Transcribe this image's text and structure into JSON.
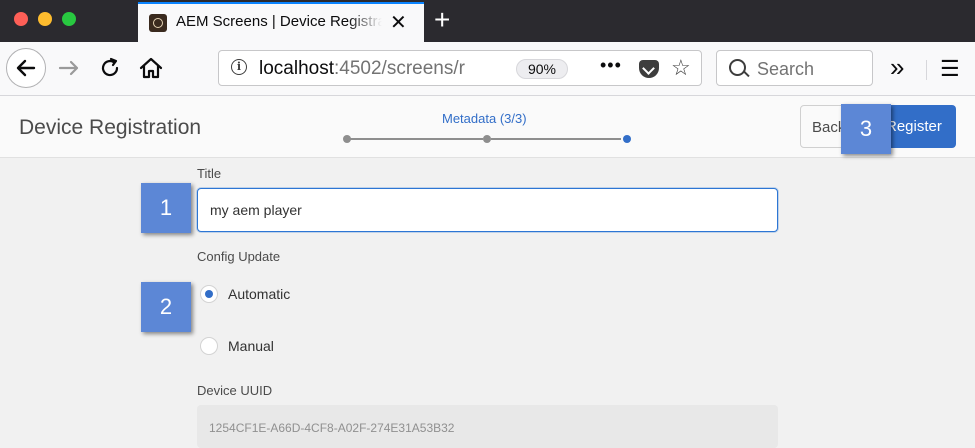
{
  "browser": {
    "tab_title": "AEM Screens | Device Registration",
    "tab_close": "✕",
    "new_tab": "+",
    "url_host": "localhost",
    "url_rest": ":4502/screens/r",
    "zoom": "90%",
    "page_actions": "•••",
    "search_placeholder": "Search",
    "overflow": "»",
    "menu": "☰"
  },
  "page": {
    "title": "Device Registration",
    "step_label": "Metadata (3/3)",
    "step_current": 3,
    "step_total": 3,
    "back_label": "Back",
    "register_label": "Register"
  },
  "form": {
    "title_label": "Title",
    "title_value": "my aem player",
    "config_label": "Config Update",
    "options": [
      "Automatic",
      "Manual"
    ],
    "selected": "Automatic",
    "uuid_label": "Device UUID",
    "uuid_value": "1254CF1E-A66D-4CF8-A02F-274E31A53B32"
  },
  "callouts": [
    "1",
    "2",
    "3"
  ],
  "colors": {
    "accent": "#326ec8",
    "callout": "#5c87d6",
    "chrome_dark": "#2b2a2f"
  }
}
